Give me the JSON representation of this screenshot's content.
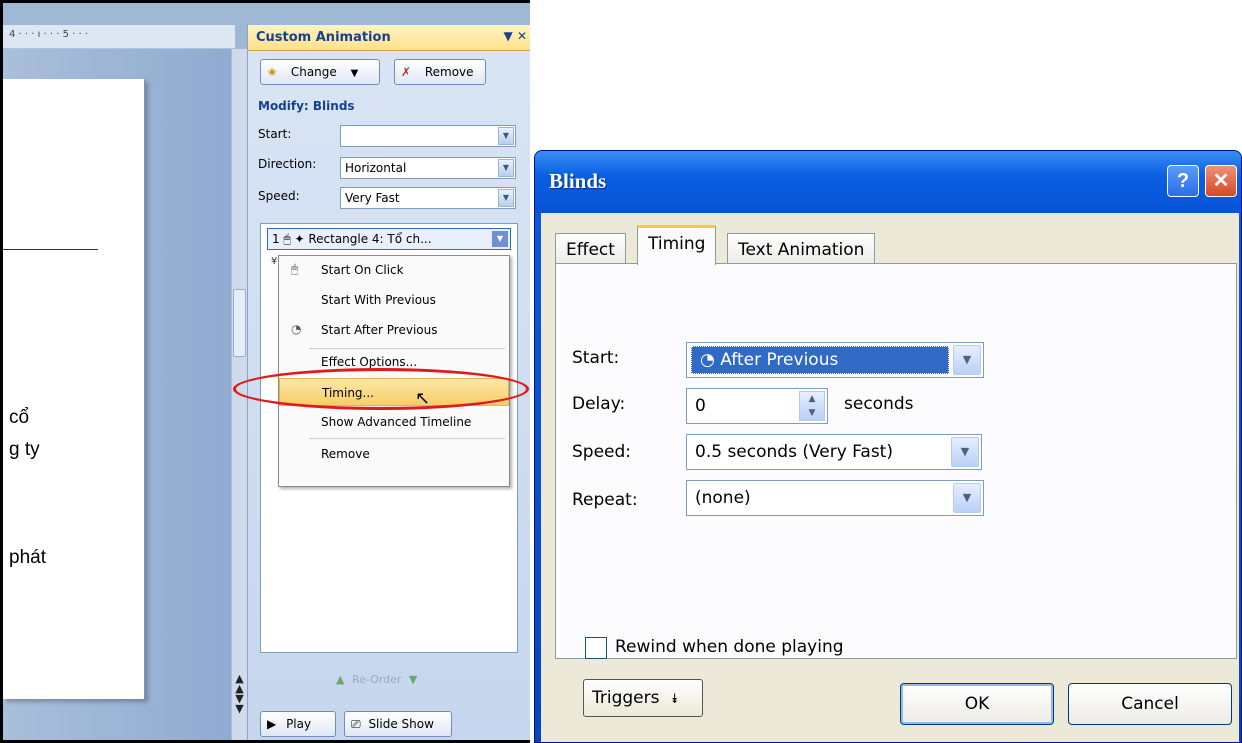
{
  "ruler": {
    "text": "4 · · · ı · · · 5 · · ·"
  },
  "slide": {
    "lines": [
      "cổ",
      "g ty",
      "phát"
    ]
  },
  "taskpane": {
    "title": "Custom Animation",
    "title_controls": "▼ ✕",
    "change_label": "Change",
    "remove_label": "Remove",
    "modify_title": "Modify: Blinds",
    "start_label": "Start:",
    "start_value": "",
    "direction_label": "Direction:",
    "direction_value": "Horizontal",
    "speed_label": "Speed:",
    "speed_value": "Very Fast",
    "anim_item": "1 🖱  ✦ Rectangle 4: Tổ ch...",
    "menu": [
      "Start On Click",
      "Start With Previous",
      "Start After Previous",
      "Effect Options...",
      "Timing...",
      "Show Advanced Timeline",
      "Remove"
    ],
    "reorder_label": "Re-Order",
    "play_label": "Play",
    "slideshow_label": "Slide Show"
  },
  "dialog": {
    "title": "Blinds",
    "help_label": "?",
    "close_label": "✕",
    "tabs": [
      "Effect",
      "Timing",
      "Text Animation"
    ],
    "start_label": "Start:",
    "start_value": "After Previous",
    "delay_label": "Delay:",
    "delay_value": "0",
    "delay_unit": "seconds",
    "speed_label": "Speed:",
    "speed_value": "0.5 seconds (Very Fast)",
    "repeat_label": "Repeat:",
    "repeat_value": "(none)",
    "rewind_label": "Rewind when done playing",
    "triggers_label": "Triggers",
    "ok_label": "OK",
    "cancel_label": "Cancel"
  },
  "colors": {
    "annotation_ellipse": "#e0191b",
    "xp_title_blue": "#0a5fe2",
    "menu_highlight": "#f8cf66"
  }
}
